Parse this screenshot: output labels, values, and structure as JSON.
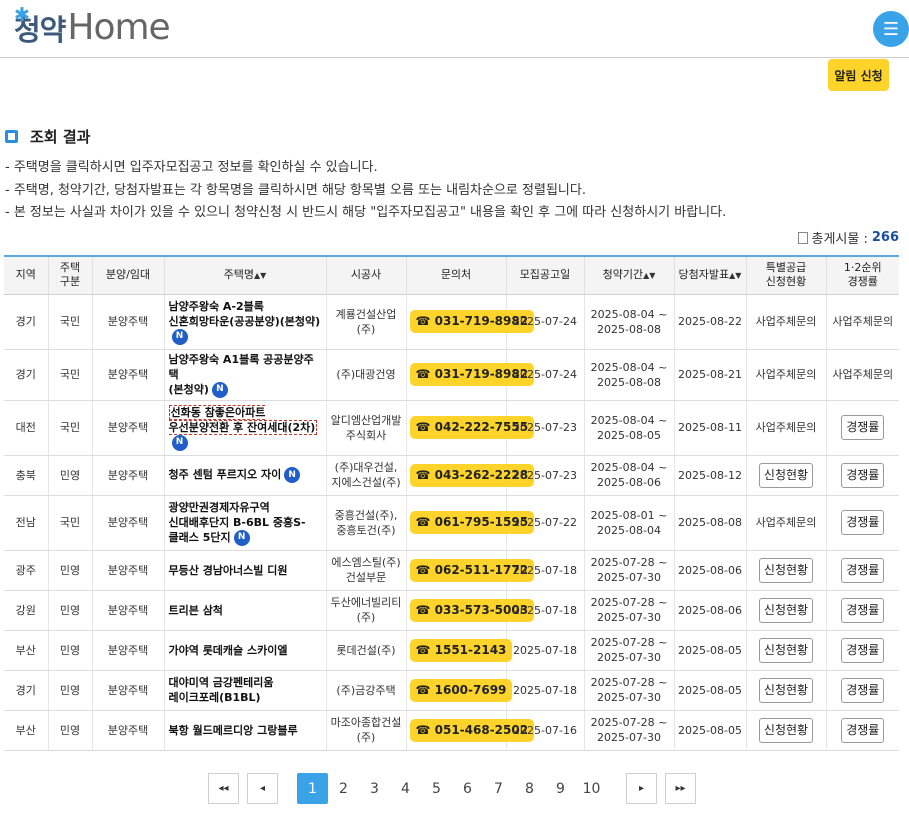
{
  "header": {
    "logo_korean": "청약",
    "logo_english": "Home",
    "menu_icon": "hamburger-icon"
  },
  "alarm_button": "알림 신청",
  "section_title": "조회 결과",
  "notes": [
    "-  주택명을 클릭하시면 입주자모집공고 정보를 확인하실 수 있습니다.",
    "-  주택명, 청약기간, 당첨자발표는 각 항목명을 클릭하시면 해당 항목별 오름 또는 내림차순으로 정렬됩니다.",
    "-  본 정보는 사실과 차이가 있을 수 있으니 청약신청 시 반드시 해당 \"입주자모집공고\" 내용을 확인 후 그에 따라 신청하시기 바랍니다."
  ],
  "total": {
    "label": "총게시물 :",
    "count": "266"
  },
  "table": {
    "headers": {
      "region": "지역",
      "type": "주택\n구분",
      "supply": "분양/임대",
      "name": "주택명",
      "builder": "시공사",
      "contact": "문의처",
      "notice_date": "모집공고일",
      "period": "청약기간",
      "winner_date": "당첨자발표",
      "special": "특별공급\n신청현황",
      "rate": "1·2순위\n경쟁률"
    },
    "rows": [
      {
        "region": "경기",
        "type": "국민",
        "supply": "분양주택",
        "name": "남양주왕숙 A-2블록\n신혼희망타운(공공분양)(본청약)",
        "new": true,
        "builder": "계룡건설산업\n(주)",
        "phone": "031-719-8982",
        "notice": "2025-07-24",
        "period": "2025-08-04 ~\n2025-08-08",
        "winner": "2025-08-22",
        "special": "사업주체문의",
        "special_btn": false,
        "rate": "사업주체문의",
        "rate_btn": false
      },
      {
        "region": "경기",
        "type": "국민",
        "supply": "분양주택",
        "name": "남양주왕숙 A1블록 공공분양주택\n(본청약)",
        "new": true,
        "builder": "(주)대광건영",
        "phone": "031-719-8982",
        "notice": "2025-07-24",
        "period": "2025-08-04 ~\n2025-08-08",
        "winner": "2025-08-21",
        "special": "사업주체문의",
        "special_btn": false,
        "rate": "사업주체문의",
        "rate_btn": false
      },
      {
        "region": "대전",
        "type": "국민",
        "supply": "분양주택",
        "name": "선화동 참좋은아파트\n우선분양전환 후 잔여세대(2차)",
        "new": true,
        "highlight": true,
        "builder": "알디엠산업개발\n주식회사",
        "phone": "042-222-7555",
        "notice": "2025-07-23",
        "period": "2025-08-04 ~\n2025-08-05",
        "winner": "2025-08-11",
        "special": "사업주체문의",
        "special_btn": false,
        "rate": "경쟁률",
        "rate_btn": true
      },
      {
        "region": "충북",
        "type": "민영",
        "supply": "분양주택",
        "name": "청주 센텀 푸르지오 자이",
        "new": true,
        "builder": "(주)대우건설,\n지에스건설(주)",
        "phone": "043-262-2228",
        "notice": "2025-07-23",
        "period": "2025-08-04 ~\n2025-08-06",
        "winner": "2025-08-12",
        "special": "신청현황",
        "special_btn": true,
        "rate": "경쟁률",
        "rate_btn": true
      },
      {
        "region": "전남",
        "type": "국민",
        "supply": "분양주택",
        "name": "광양만권경제자유구역\n신대배후단지 B-6BL 중흥S-\n클래스 5단지",
        "new": true,
        "builder": "중흥건설(주),\n중흥토건(주)",
        "phone": "061-795-1595",
        "notice": "2025-07-22",
        "period": "2025-08-01 ~\n2025-08-04",
        "winner": "2025-08-08",
        "special": "사업주체문의",
        "special_btn": false,
        "rate": "경쟁률",
        "rate_btn": true
      },
      {
        "region": "광주",
        "type": "민영",
        "supply": "분양주택",
        "name": "무등산 경남아너스빌 디원",
        "new": false,
        "builder": "에스엠스틸(주)\n건설부문",
        "phone": "062-511-1772",
        "notice": "2025-07-18",
        "period": "2025-07-28 ~\n2025-07-30",
        "winner": "2025-08-06",
        "special": "신청현황",
        "special_btn": true,
        "rate": "경쟁률",
        "rate_btn": true
      },
      {
        "region": "강원",
        "type": "민영",
        "supply": "분양주택",
        "name": "트리븐 삼척",
        "new": false,
        "builder": "두산에너빌리티\n(주)",
        "phone": "033-573-5003",
        "notice": "2025-07-18",
        "period": "2025-07-28 ~\n2025-07-30",
        "winner": "2025-08-06",
        "special": "신청현황",
        "special_btn": true,
        "rate": "경쟁률",
        "rate_btn": true
      },
      {
        "region": "부산",
        "type": "민영",
        "supply": "분양주택",
        "name": "가야역 롯데캐슬 스카이엘",
        "new": false,
        "builder": "롯데건설(주)",
        "phone": "1551-2143",
        "notice": "2025-07-18",
        "period": "2025-07-28 ~\n2025-07-30",
        "winner": "2025-08-05",
        "special": "신청현황",
        "special_btn": true,
        "rate": "경쟁률",
        "rate_btn": true
      },
      {
        "region": "경기",
        "type": "민영",
        "supply": "분양주택",
        "name": "대야미역 금강펜테리움\n레이크포레(B1BL)",
        "new": false,
        "builder": "(주)금강주택",
        "phone": "1600-7699",
        "notice": "2025-07-18",
        "period": "2025-07-28 ~\n2025-07-30",
        "winner": "2025-08-05",
        "special": "신청현황",
        "special_btn": true,
        "rate": "경쟁률",
        "rate_btn": true
      },
      {
        "region": "부산",
        "type": "민영",
        "supply": "분양주택",
        "name": "북항 월드메르디앙 그랑블루",
        "new": false,
        "builder": "마조아종합건설\n(주)",
        "phone": "051-468-2502",
        "notice": "2025-07-16",
        "period": "2025-07-28 ~\n2025-07-30",
        "winner": "2025-08-05",
        "special": "신청현황",
        "special_btn": true,
        "rate": "경쟁률",
        "rate_btn": true
      }
    ]
  },
  "pagination": {
    "first": "«",
    "prev": "‹",
    "next": "›",
    "last": "»",
    "pages": [
      "1",
      "2",
      "3",
      "4",
      "5",
      "6",
      "7",
      "8",
      "9",
      "10"
    ],
    "current": "1"
  }
}
